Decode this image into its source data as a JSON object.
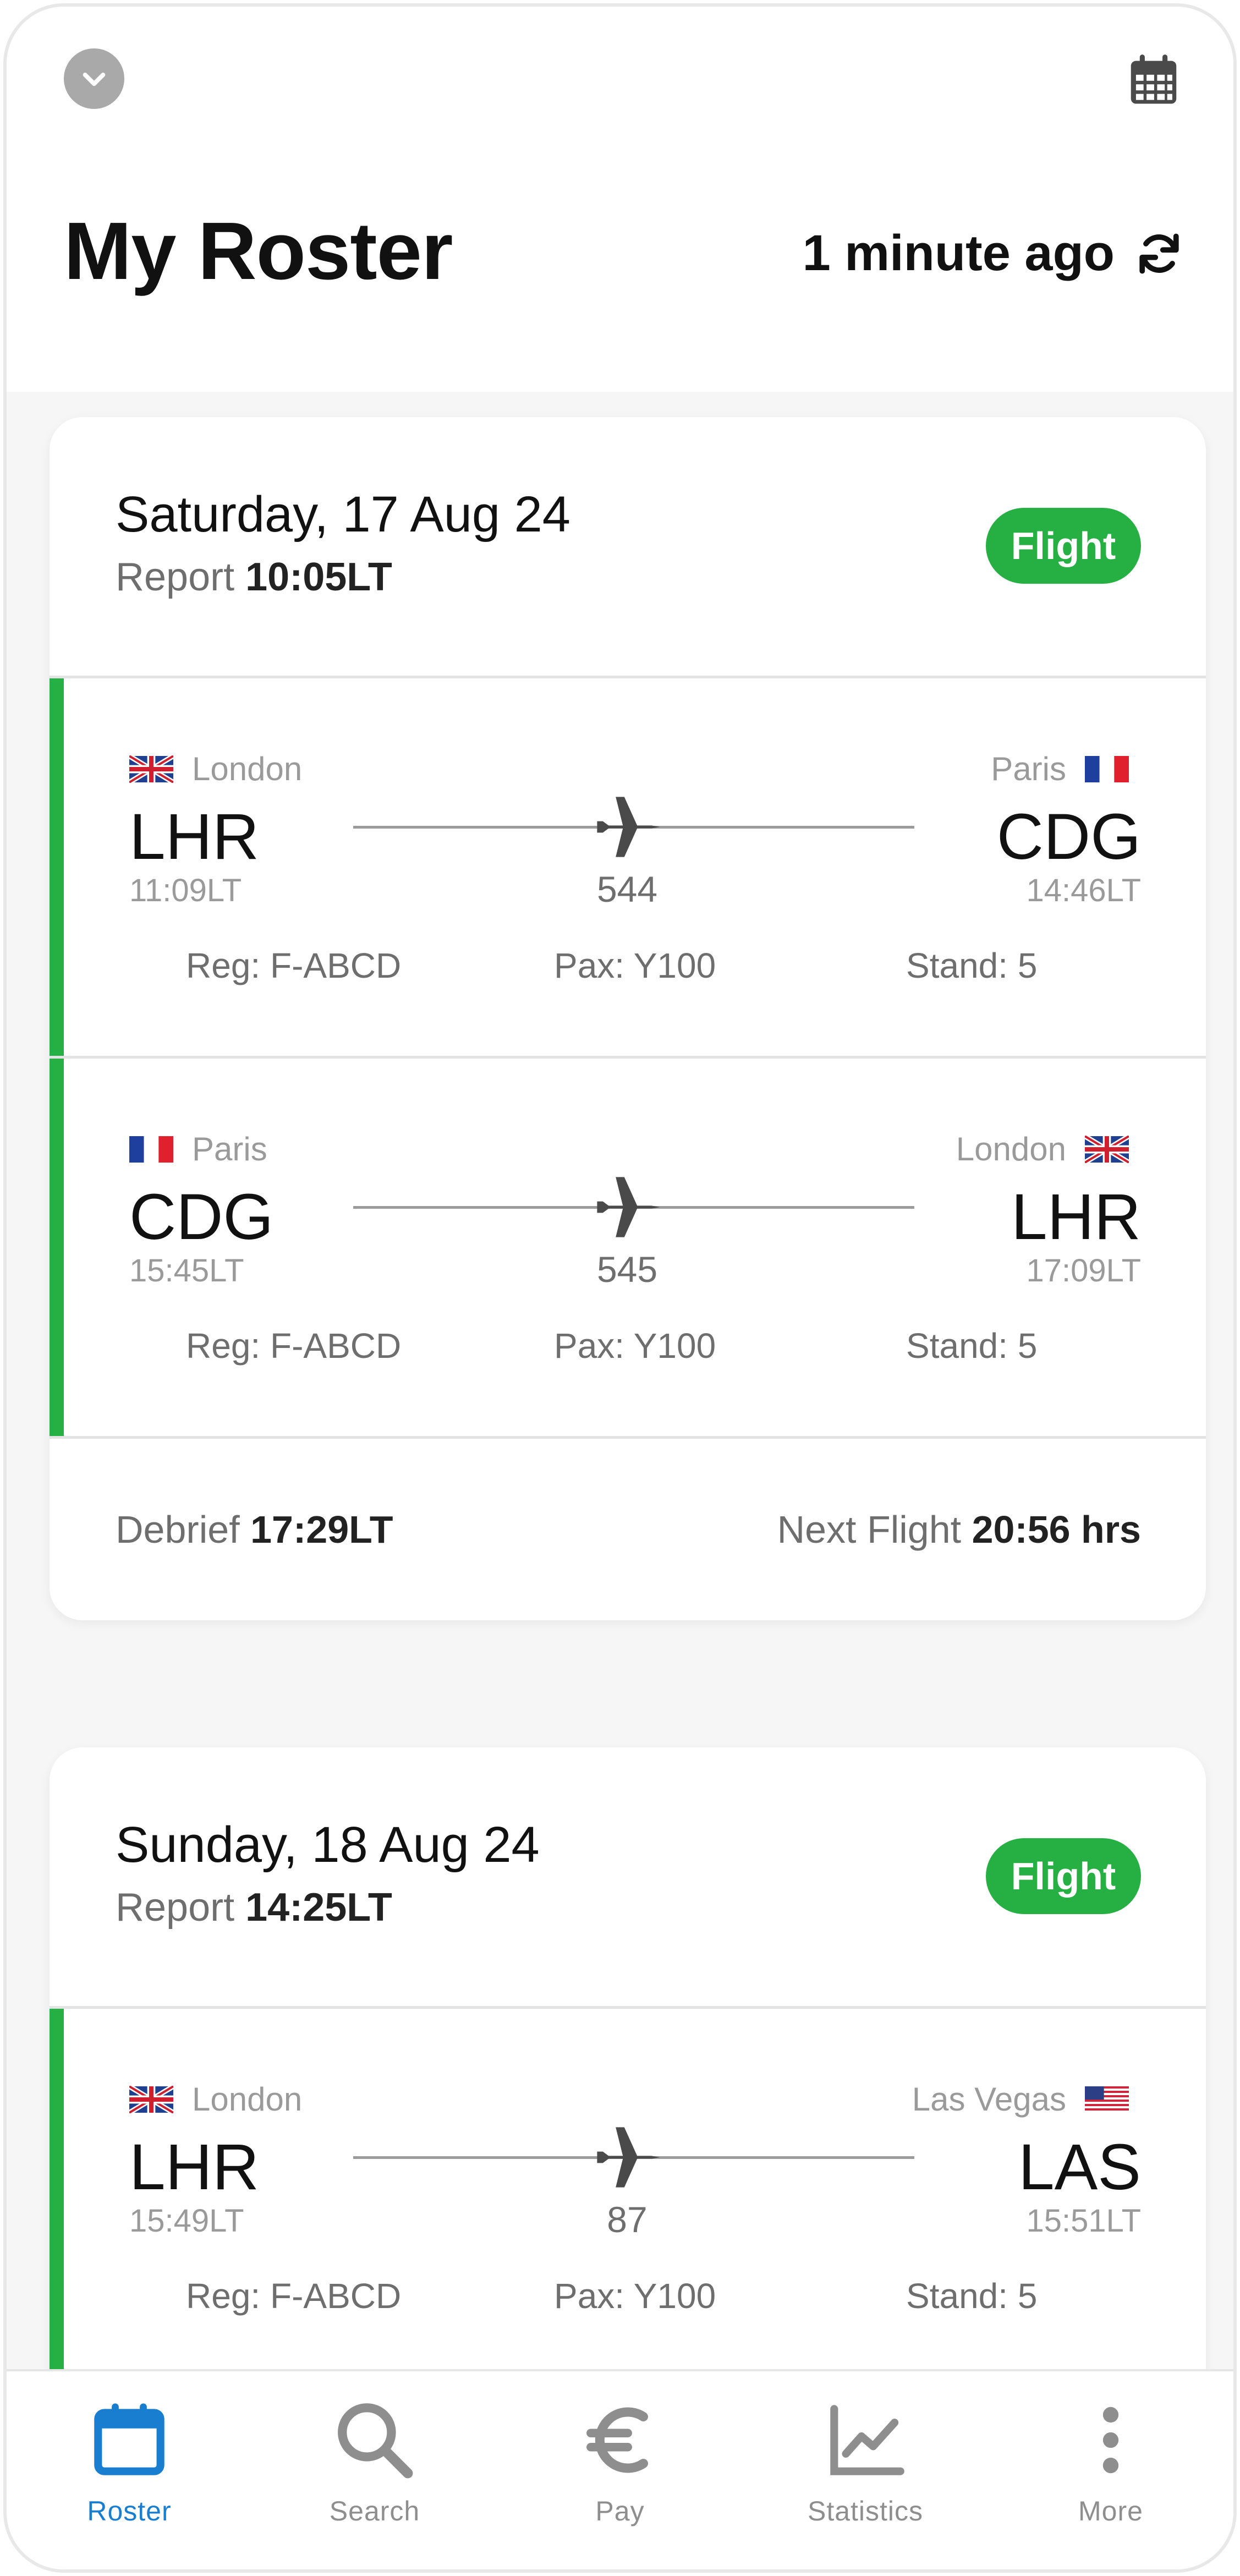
{
  "header": {
    "title": "My Roster",
    "updated": "1 minute ago"
  },
  "colors": {
    "accent_green": "#26b043",
    "active_blue": "#1a7ed0",
    "muted_text": "#6e6e6e"
  },
  "days": [
    {
      "date": "Saturday, 17 Aug 24",
      "report_label": "Report",
      "report_time": "10:05LT",
      "badge": "Flight",
      "legs": [
        {
          "from_city": "London",
          "from_code": "LHR",
          "from_time": "11:09LT",
          "from_flag": "uk-flag-icon",
          "to_city": "Paris",
          "to_code": "CDG",
          "to_time": "14:46LT",
          "to_flag": "fr-flag-icon",
          "flight_no": "544",
          "reg": "Reg: F-ABCD",
          "pax": "Pax: Y100",
          "stand": "Stand: 5"
        },
        {
          "from_city": "Paris",
          "from_code": "CDG",
          "from_time": "15:45LT",
          "from_flag": "fr-flag-icon",
          "to_city": "London",
          "to_code": "LHR",
          "to_time": "17:09LT",
          "to_flag": "uk-flag-icon",
          "flight_no": "545",
          "reg": "Reg: F-ABCD",
          "pax": "Pax: Y100",
          "stand": "Stand: 5"
        }
      ],
      "debrief_label": "Debrief",
      "debrief_time": "17:29LT",
      "next_label": "Next Flight",
      "next_value": "20:56 hrs"
    },
    {
      "date": "Sunday, 18 Aug 24",
      "report_label": "Report",
      "report_time": "14:25LT",
      "badge": "Flight",
      "legs": [
        {
          "from_city": "London",
          "from_code": "LHR",
          "from_time": "15:49LT",
          "from_flag": "uk-flag-icon",
          "to_city": "Las Vegas",
          "to_code": "LAS",
          "to_time": "15:51LT",
          "to_flag": "us-flag-icon",
          "flight_no": "87",
          "reg": "Reg: F-ABCD",
          "pax": "Pax: Y100",
          "stand": "Stand: 5"
        }
      ]
    }
  ],
  "tabs": [
    {
      "label": "Roster",
      "icon": "calendar-icon",
      "active": true
    },
    {
      "label": "Search",
      "icon": "search-icon",
      "active": false
    },
    {
      "label": "Pay",
      "icon": "euro-icon",
      "active": false
    },
    {
      "label": "Statistics",
      "icon": "chart-icon",
      "active": false
    },
    {
      "label": "More",
      "icon": "more-vertical-icon",
      "active": false
    }
  ]
}
